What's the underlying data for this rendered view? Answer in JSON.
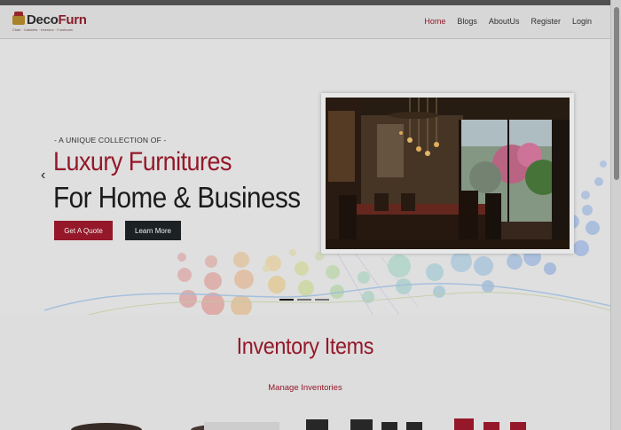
{
  "brand": {
    "name_part1": "Deco",
    "name_part2": "Furn",
    "tagline": "Chair · Cabinets · Interiors · Furnitures"
  },
  "nav": {
    "items": [
      {
        "label": "Home",
        "active": true
      },
      {
        "label": "Blogs",
        "active": false
      },
      {
        "label": "AboutUs",
        "active": false
      },
      {
        "label": "Register",
        "active": false
      },
      {
        "label": "Login",
        "active": false
      }
    ]
  },
  "hero": {
    "subtitle": "- A UNIQUE COLLECTION OF -",
    "title_line1": "Luxury Furnitures",
    "title_line2": "For Home & Business",
    "primary_button": "Get A Quote",
    "secondary_button": "Learn More",
    "prev_arrow": "‹",
    "slides_total": 3,
    "slide_active": 1
  },
  "inventory": {
    "title": "Inventory Items",
    "manage_link": "Manage Inventories"
  },
  "colors": {
    "accent": "#9c1a2c",
    "dark_button": "#1e2326",
    "background": "#e9e9e9"
  }
}
